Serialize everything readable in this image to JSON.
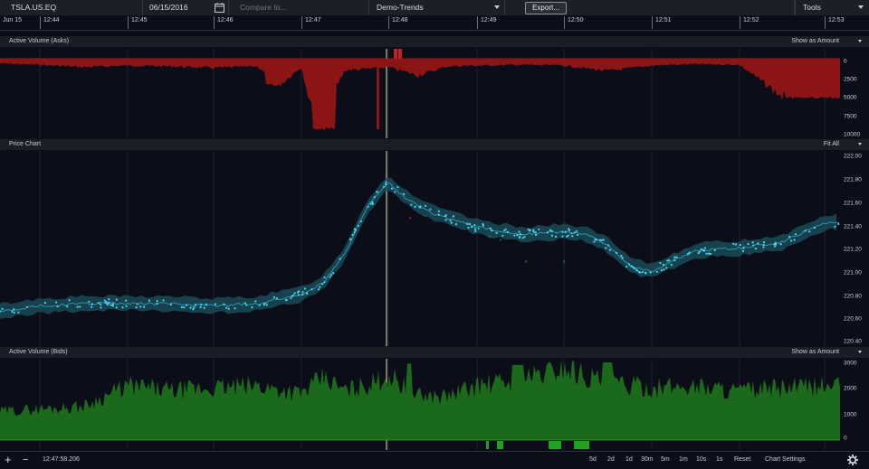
{
  "toolbar": {
    "symbol": "TSLA.US.EQ",
    "date": "06/15/2016",
    "compare_placeholder": "Compare to...",
    "layout": "Demo-Trends",
    "export_label": "Export...",
    "tools_label": "Tools"
  },
  "time_axis": {
    "labels": [
      "Jun 15",
      "12:44",
      "12:45",
      "12:46",
      "12:47",
      "12:48",
      "12:49",
      "12:50",
      "12:51",
      "12:52",
      "12:53"
    ]
  },
  "panels": {
    "asks": {
      "title": "Active Volume (Asks)",
      "option": "Show as Amount",
      "y_labels": [
        "0",
        "2500",
        "5000",
        "7500",
        "10000"
      ]
    },
    "price": {
      "title": "Price Chart",
      "option": "Fit All",
      "y_labels": [
        "222.00",
        "221.80",
        "221.60",
        "221.40",
        "221.20",
        "221.00",
        "220.80",
        "220.60",
        "220.40"
      ]
    },
    "bids": {
      "title": "Active Volume (Bids)",
      "option": "Show as Amount",
      "y_labels": [
        "3000",
        "2000",
        "1000",
        "0"
      ]
    }
  },
  "bottom": {
    "cursor_time": "12:47:58.206",
    "zoom_in": "+",
    "zoom_out": "−",
    "ranges": [
      "5d",
      "2d",
      "1d",
      "30m",
      "5m",
      "1m",
      "10s",
      "1s"
    ],
    "reset_label": "Reset",
    "settings_label": "Chart Settings"
  },
  "colors": {
    "ask_fill": "#8b1414",
    "bid_fill": "#1b6a1b",
    "price_band": "#1a4b57",
    "price_dot": "#4fd2ee",
    "cursor_line": "#e8e6b0"
  },
  "chart_data": [
    {
      "type": "area",
      "series": [
        {
          "name": "Active Volume (Asks)",
          "x": [
            "12:43:30",
            "12:44",
            "12:44:30",
            "12:45",
            "12:45:30",
            "12:46",
            "12:46:30",
            "12:46:45",
            "12:47",
            "12:47:10",
            "12:47:30",
            "12:47:50",
            "12:48",
            "12:48:20",
            "12:48:40",
            "12:49",
            "12:49:30",
            "12:50",
            "12:50:30",
            "12:51",
            "12:51:30",
            "12:52",
            "12:52:30",
            "12:53"
          ],
          "values": [
            600,
            800,
            1100,
            900,
            1000,
            1200,
            1000,
            3400,
            1100,
            9000,
            1500,
            1300,
            1100,
            2200,
            1000,
            900,
            800,
            900,
            1600,
            900,
            700,
            800,
            5000,
            800
          ]
        }
      ],
      "ylim": [
        0,
        10000
      ]
    },
    {
      "type": "line",
      "series": [
        {
          "name": "Price",
          "x": [
            "12:43:30",
            "12:44",
            "12:44:30",
            "12:45",
            "12:45:30",
            "12:46",
            "12:46:30",
            "12:47",
            "12:47:15",
            "12:47:30",
            "12:47:45",
            "12:48",
            "12:48:10",
            "12:48:30",
            "12:49",
            "12:49:30",
            "12:50",
            "12:50:15",
            "12:50:30",
            "12:50:45",
            "12:51",
            "12:51:30",
            "12:52",
            "12:52:30",
            "12:53"
          ],
          "values": [
            220.65,
            220.7,
            220.72,
            220.72,
            220.72,
            220.7,
            220.72,
            220.8,
            220.9,
            221.15,
            221.55,
            221.77,
            221.65,
            221.5,
            221.38,
            221.32,
            221.34,
            221.32,
            221.22,
            221.05,
            221.0,
            221.18,
            221.2,
            221.25,
            221.42
          ]
        }
      ],
      "ylim": [
        220.4,
        222.0
      ]
    },
    {
      "type": "area",
      "series": [
        {
          "name": "Active Volume (Bids)",
          "x": [
            "12:43:30",
            "12:44",
            "12:44:30",
            "12:45",
            "12:45:30",
            "12:46",
            "12:46:30",
            "12:47",
            "12:47:15",
            "12:47:30",
            "12:47:50",
            "12:48",
            "12:48:20",
            "12:48:40",
            "12:49",
            "12:49:30",
            "12:50",
            "12:50:30",
            "12:51",
            "12:51:30",
            "12:52",
            "12:52:30",
            "12:53"
          ],
          "values": [
            1100,
            1200,
            1300,
            2100,
            1900,
            2000,
            2100,
            1800,
            2400,
            1900,
            2200,
            2500,
            1700,
            1700,
            2100,
            2300,
            2800,
            2200,
            2000,
            2100,
            1900,
            2000,
            2100
          ]
        }
      ],
      "ylim": [
        0,
        3000
      ]
    }
  ]
}
